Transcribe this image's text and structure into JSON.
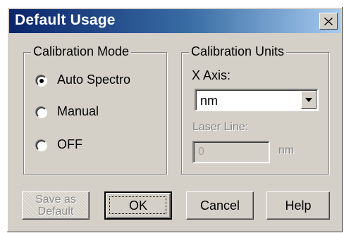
{
  "window": {
    "title": "Default Usage",
    "close_glyph": "close-icon"
  },
  "calibration_mode": {
    "legend": "Calibration Mode",
    "options": [
      {
        "label": "Auto Spectro",
        "selected": true
      },
      {
        "label": "Manual",
        "selected": false
      },
      {
        "label": "OFF",
        "selected": false
      }
    ]
  },
  "calibration_units": {
    "legend": "Calibration Units",
    "x_axis_label": "X Axis:",
    "x_axis_value": "nm",
    "laser_line_label": "Laser Line:",
    "laser_line_value": "0",
    "laser_line_unit": "nm"
  },
  "buttons": {
    "save_default_line1": "Save as",
    "save_default_line2": "Default",
    "ok": "OK",
    "cancel": "Cancel",
    "help": "Help"
  }
}
